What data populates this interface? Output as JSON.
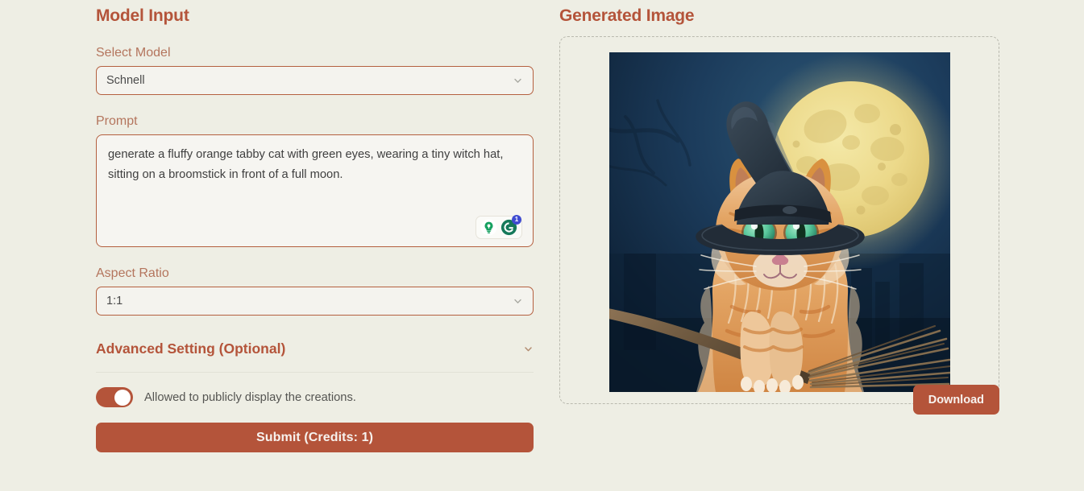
{
  "left": {
    "title": "Model Input",
    "model": {
      "label": "Select Model",
      "value": "Schnell",
      "chevron_icon": "chevron-down-icon"
    },
    "prompt": {
      "label": "Prompt",
      "value": "generate a fluffy orange tabby cat with green eyes, wearing a tiny witch hat, sitting on a broomstick in front of a full moon.",
      "placeholder": "",
      "tools": [
        {
          "icon": "lightbulb-icon",
          "badge": ""
        },
        {
          "icon": "grammarly-icon",
          "badge": "1"
        }
      ]
    },
    "aspect_ratio": {
      "label": "Aspect Ratio",
      "value": "1:1",
      "chevron_icon": "chevron-down-icon"
    },
    "advanced": {
      "label": "Advanced Setting (Optional)",
      "chevron_icon": "chevron-down-icon",
      "expanded": "false"
    },
    "public_toggle": {
      "label": "Allowed to publicly display the creations.",
      "state": "on"
    },
    "submit_label": "Submit (Credits: 1)"
  },
  "right": {
    "title": "Generated Image",
    "download_label": "Download",
    "image_alt": "fluffy orange tabby cat with green eyes wearing a black witch hat, sitting on a broomstick in front of a full moon"
  },
  "colors": {
    "background": "#eeeee4",
    "accent": "#b4543a",
    "label": "#b4755d",
    "field_border": "#b4603f",
    "field_fill": "#f4f3ee",
    "dashed_border": "#b9b9ae",
    "badge_blue": "#3f4bd1",
    "grammarly_green": "#15a05f",
    "night_sky": "#153050",
    "moon": "#ead98a",
    "cat_fur": "#d98a4c",
    "cat_eye": "#5fd0a8",
    "hat": "#2e3a47"
  }
}
